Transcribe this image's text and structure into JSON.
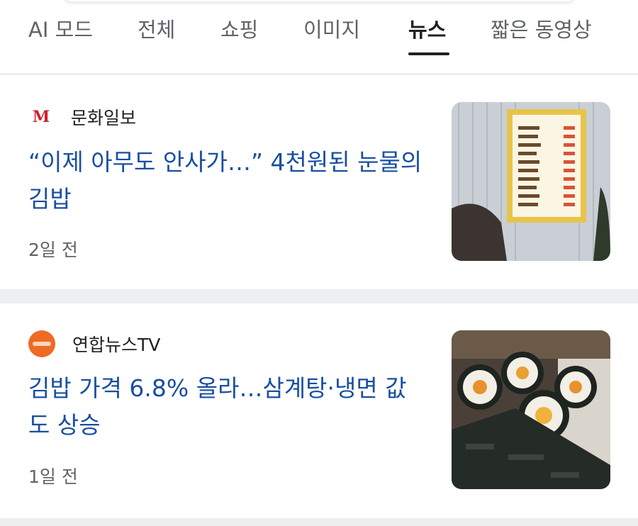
{
  "tabs": [
    {
      "label": "AI 모드",
      "active": false
    },
    {
      "label": "전체",
      "active": false
    },
    {
      "label": "쇼핑",
      "active": false
    },
    {
      "label": "이미지",
      "active": false
    },
    {
      "label": "뉴스",
      "active": true
    },
    {
      "label": "짧은 동영상",
      "active": false
    }
  ],
  "articles": [
    {
      "source": "문화일보",
      "source_logo_text": "M",
      "headline": "“이제 아무도 안사가…” 4천원된 눈물의 김밥",
      "time": "2일 전",
      "thumbnail": "kimbap-menu-board-photo"
    },
    {
      "source": "연합뉴스TV",
      "headline": "김밥 가격 6.8% 올라…삼계탕·냉면 값도 상승",
      "time": "1일 전",
      "thumbnail": "kimbap-rolls-photo"
    }
  ],
  "colors": {
    "headline": "#1a4fa0",
    "active_tab": "#202124",
    "inactive_tab": "#5f6368",
    "divider": "#eceef0"
  }
}
